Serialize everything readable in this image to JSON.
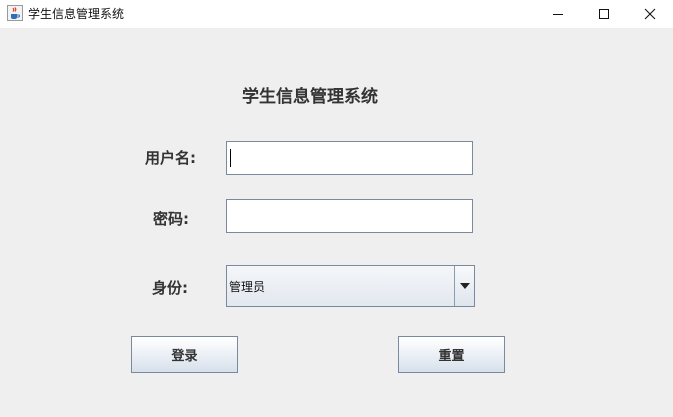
{
  "window": {
    "title": "学生信息管理系统",
    "icons": {
      "app": "java-cup-icon",
      "minimize": "minimize-icon",
      "maximize": "maximize-icon",
      "close": "close-icon"
    }
  },
  "form": {
    "heading": "学生信息管理系统",
    "username": {
      "label": "用户名:",
      "value": ""
    },
    "password": {
      "label": "密码:",
      "value": ""
    },
    "role": {
      "label": "身份:",
      "selected": "管理员"
    }
  },
  "buttons": {
    "login": "登录",
    "reset": "重置"
  }
}
